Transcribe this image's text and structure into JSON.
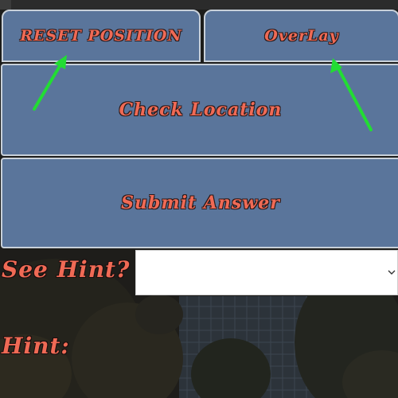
{
  "buttons": {
    "reset_position": "RESET POSITION",
    "overlay": "OverLay",
    "check_location": "Check Location",
    "submit_answer": "Submit Answer"
  },
  "hint_select": {
    "label": "See Hint?",
    "selected": ""
  },
  "hint": {
    "label": "Hint:",
    "text": ""
  },
  "colors": {
    "button_bg": "#5a759b",
    "button_text": "#f06a55",
    "arrow": "#22dd33"
  },
  "icons": {
    "arrow": "green-arrow-icon",
    "select_chevron": "chevron-down-icon"
  }
}
